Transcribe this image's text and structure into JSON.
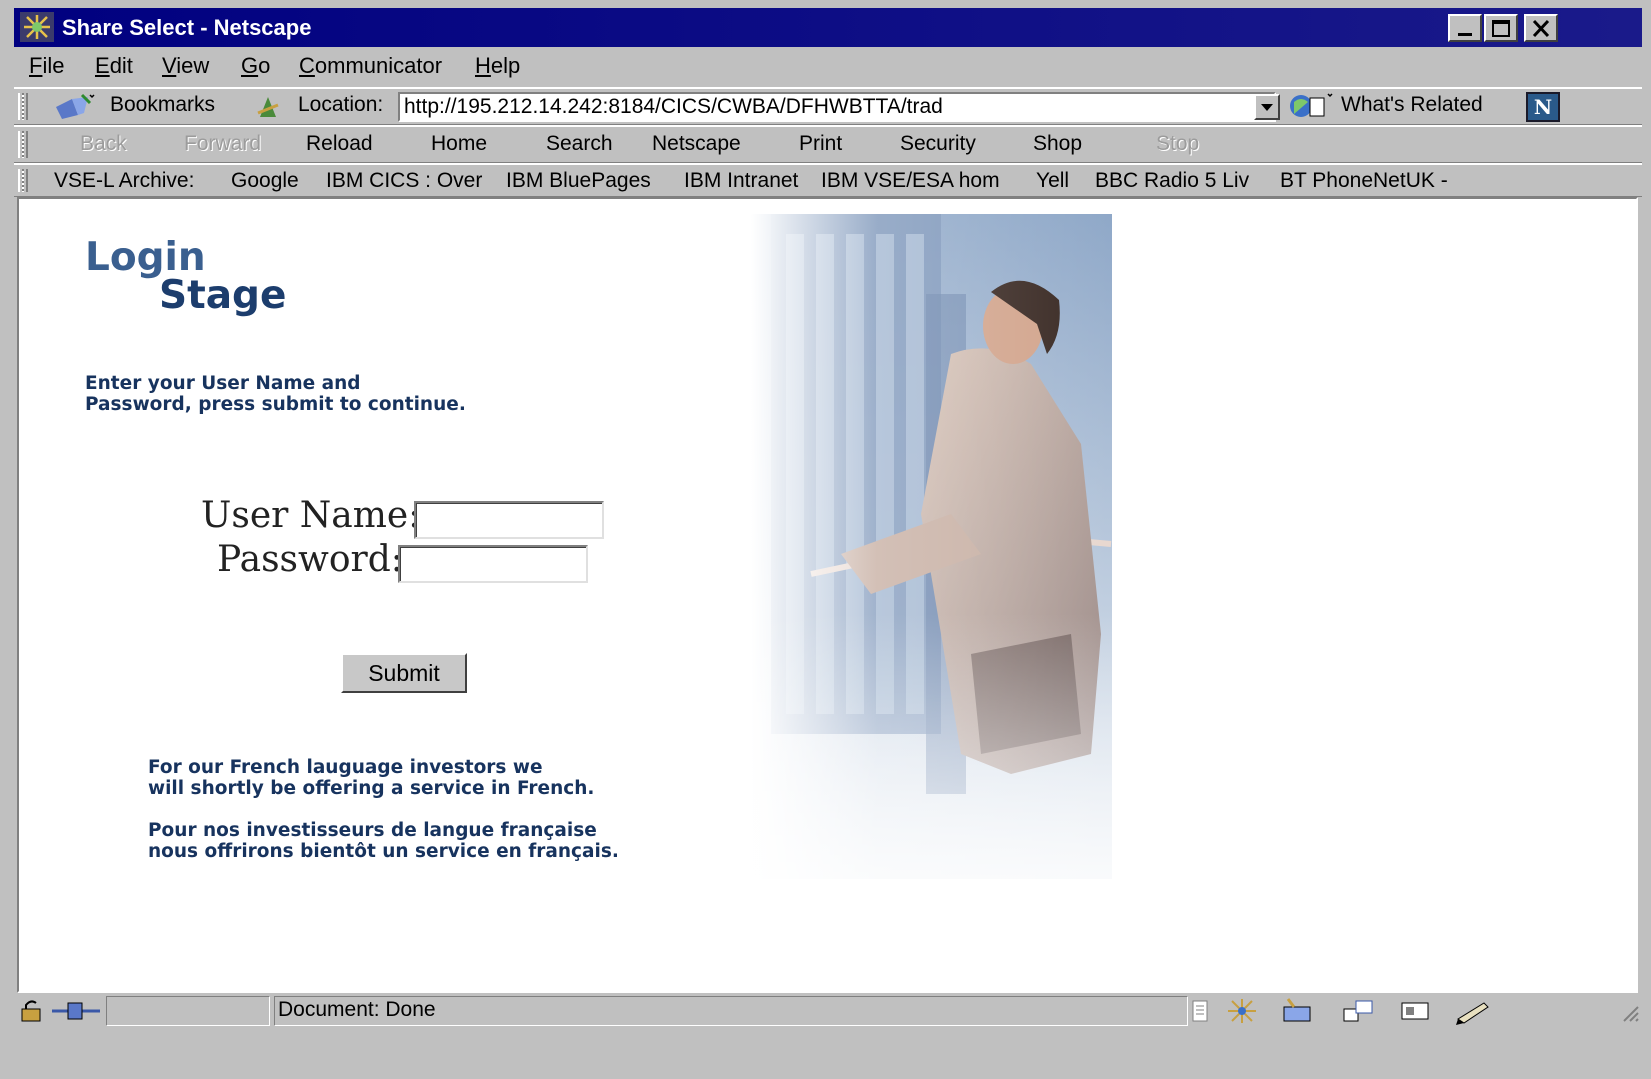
{
  "window": {
    "title": "Share Select - Netscape"
  },
  "menu": {
    "items": [
      {
        "first": "F",
        "rest": "ile"
      },
      {
        "first": "E",
        "rest": "dit"
      },
      {
        "first": "V",
        "rest": "iew"
      },
      {
        "first": "G",
        "rest": "o"
      },
      {
        "first": "C",
        "rest": "ommunicator"
      },
      {
        "first": "H",
        "rest": "elp"
      }
    ]
  },
  "location_bar": {
    "bookmarks_label": "Bookmarks",
    "location_label": "Location:",
    "url": "http://195.212.14.242:8184/CICS/CWBA/DFHWBTTA/trad",
    "whats_related_label": "What's Related"
  },
  "nav_toolbar": {
    "back": "Back",
    "forward": "Forward",
    "reload": "Reload",
    "home": "Home",
    "search": "Search",
    "netscape": "Netscape",
    "print": "Print",
    "security": "Security",
    "shop": "Shop",
    "stop": "Stop"
  },
  "personal_toolbar": {
    "links": [
      "VSE-L Archive:",
      "Google",
      "IBM CICS : Over",
      "IBM BluePages",
      "IBM Intranet",
      "IBM VSE/ESA hom",
      "Yell",
      "BBC Radio 5 Liv",
      "BT PhoneNetUK -"
    ]
  },
  "page": {
    "logo_line1": "Login",
    "logo_line2": "Stage",
    "instruction_line1": "Enter your User Name and",
    "instruction_line2": "Password, press submit to continue.",
    "username_label": "User Name:",
    "username_value": "",
    "password_label": "Password:",
    "password_value": "",
    "submit_label": "Submit",
    "english_note_line1": "For our French lauguage investors we",
    "english_note_line2": "will shortly be offering a service in French.",
    "french_note_line1": "Pour nos investisseurs de langue française",
    "french_note_line2": "nous offrirons bientôt un service en français."
  },
  "status_bar": {
    "text": "Document: Done"
  }
}
